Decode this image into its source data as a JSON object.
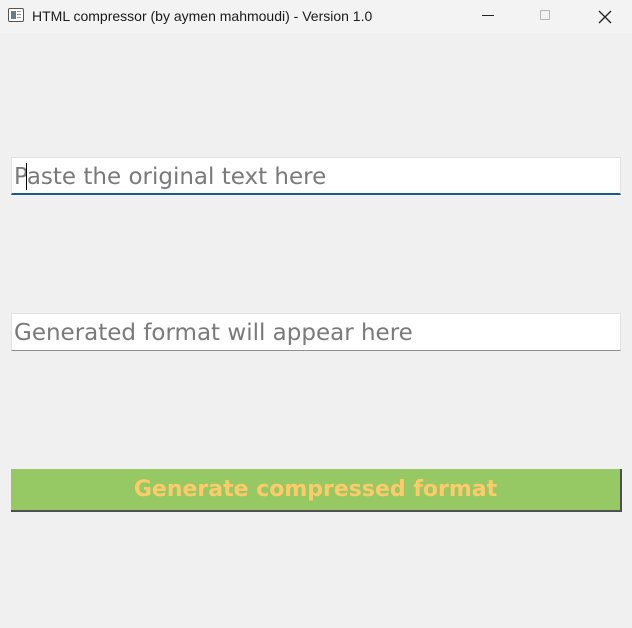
{
  "window": {
    "title": "HTML compressor (by aymen mahmoudi) - Version 1.0",
    "app_icon": "window-app-icon",
    "controls": {
      "minimize_icon": "minimize-icon",
      "maximize_icon": "maximize-icon",
      "close_icon": "close-icon"
    }
  },
  "input": {
    "value": "",
    "placeholder": "Paste the original text here",
    "focused": true,
    "accent_color": "#1c5a87"
  },
  "output": {
    "value": "",
    "placeholder": "Generated format will appear here"
  },
  "generate_button": {
    "label": "Generate compressed format",
    "background_color": "#96c864",
    "text_color": "#ffcb6a"
  }
}
